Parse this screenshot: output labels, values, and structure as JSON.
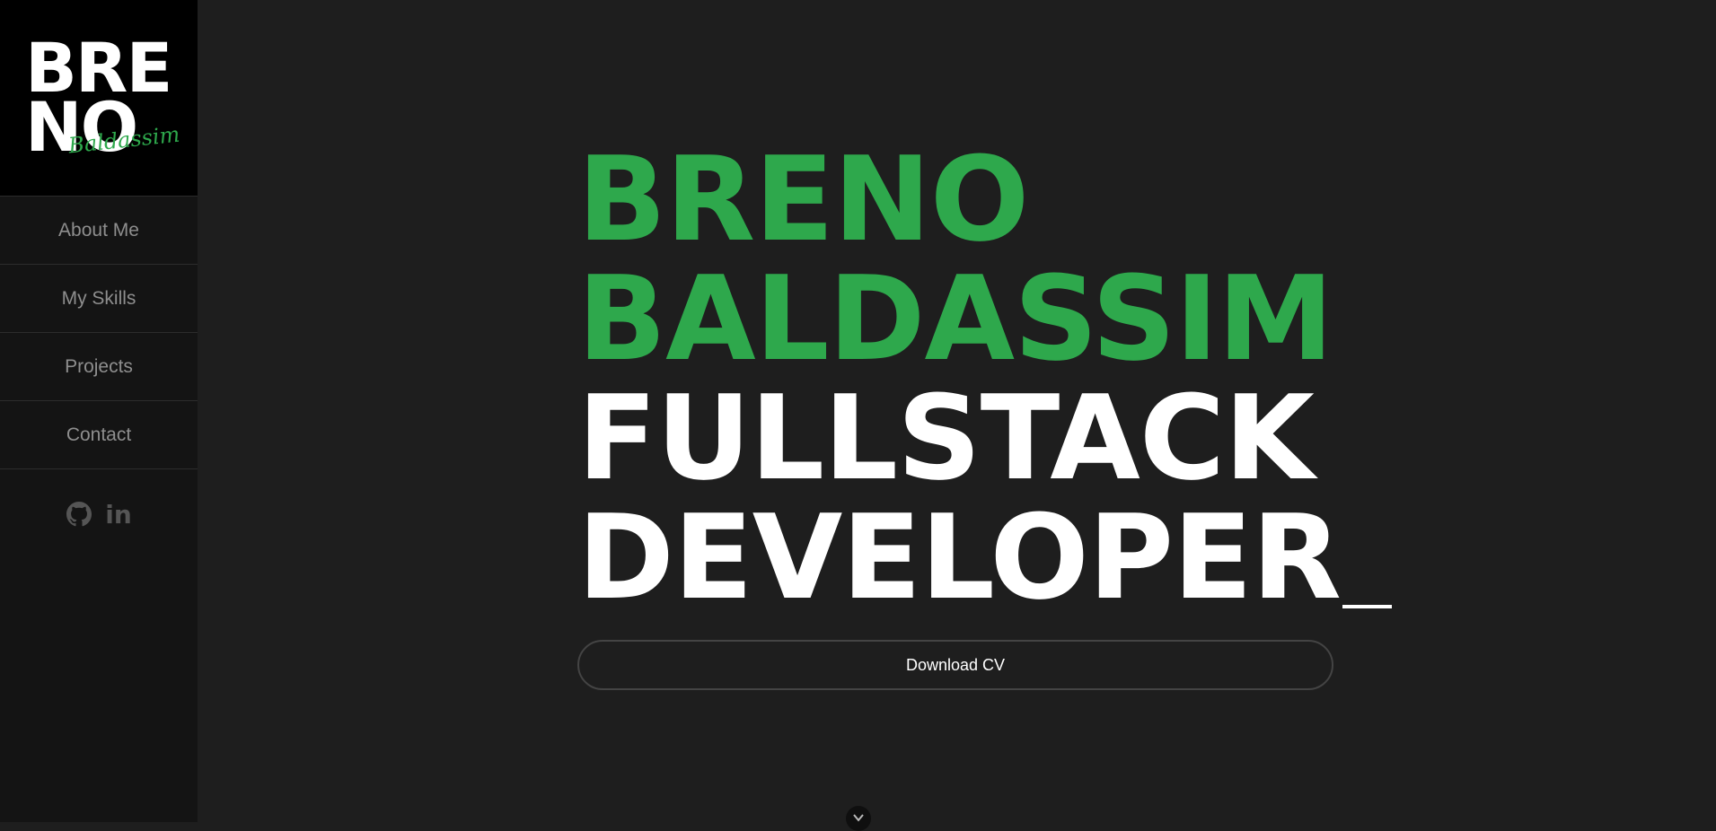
{
  "brand": {
    "logo_line1": "BRE",
    "logo_line2": "NO",
    "logo_script": "Baldassim"
  },
  "nav": {
    "items": [
      {
        "label": "About Me"
      },
      {
        "label": "My Skills"
      },
      {
        "label": "Projects"
      },
      {
        "label": "Contact"
      }
    ]
  },
  "socials": {
    "github_icon": "github-icon",
    "linkedin_icon": "linkedin-icon",
    "linkedin_glyph": "in"
  },
  "hero": {
    "line1": "BRENO",
    "line2": "BALDASSIM",
    "line3": "FULLSTACK",
    "line4": "DEVELOPER"
  },
  "cta": {
    "download_label": "Download CV"
  },
  "scroll": {
    "icon": "chevron-down-icon"
  },
  "colors": {
    "accent": "#2ea84c",
    "background": "#1e1e1e",
    "sidebar": "#141414"
  }
}
